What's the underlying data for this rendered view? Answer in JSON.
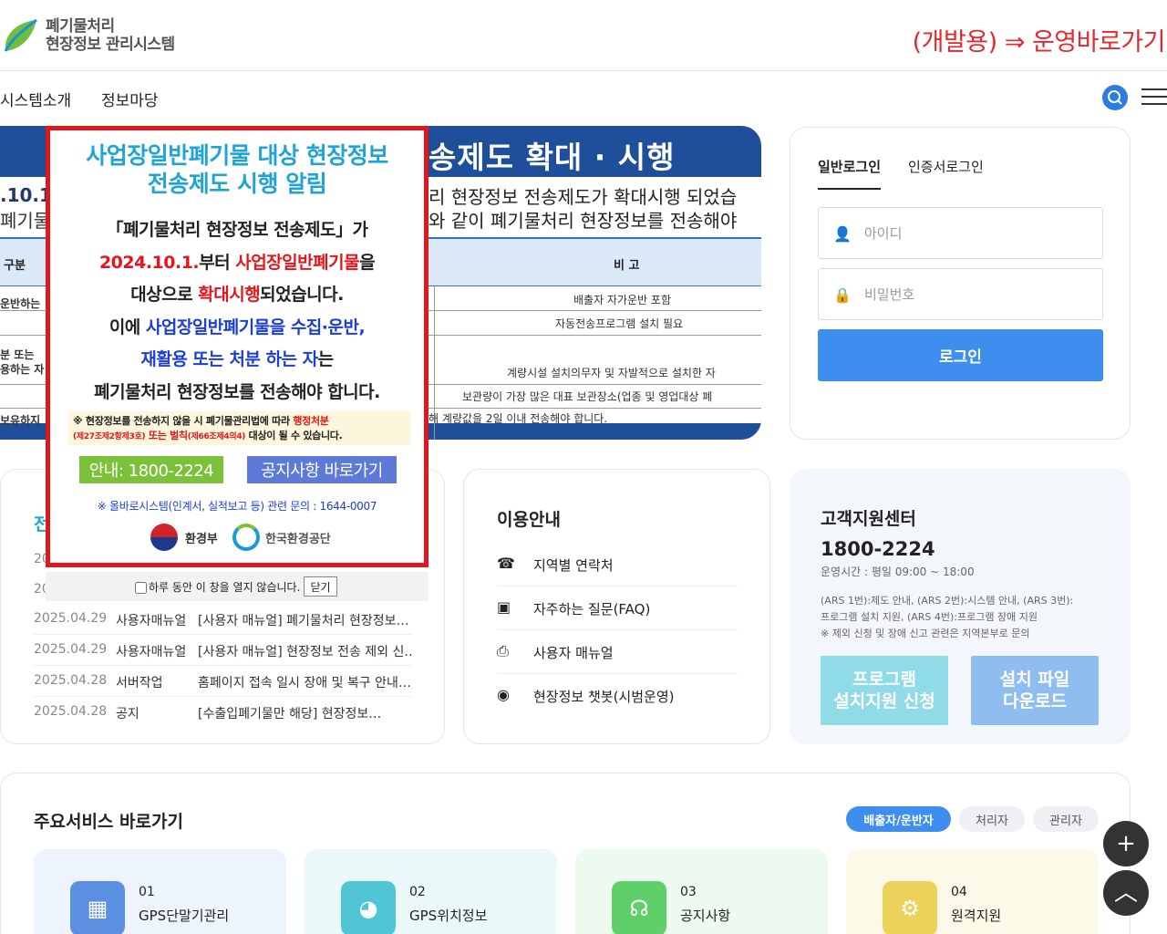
{
  "header": {
    "logo_line1": "폐기물처리",
    "logo_line2": "현장정보 관리시스템",
    "dev_link": "(개발용) ⇒ 운영바로가기",
    "logo_icon": "leaf-logo-icon"
  },
  "nav": {
    "items": [
      "시스템소개",
      "정보마당"
    ],
    "search_icon": "search-icon",
    "menu_icon": "hamburger-menu-icon"
  },
  "banner": {
    "title": "송제도 확대 · 시행",
    "date_fragment": ".10.1",
    "left_fragment": "폐기물",
    "line1": "리 현장정보 전송제도가 확대시행 되었습",
    "line2": "와 같이 폐기물처리 현장정보를 전송해야",
    "table": {
      "col1_header": "구분",
      "col2_header": "비 고",
      "left_cells": [
        "운반하는",
        "분 또는",
        "용하는 자",
        "보유하지"
      ],
      "right_cells": [
        "배출자 자가운반 포함",
        "자동전송프로그램 설치 필요",
        "계량시설 설치의무자 및 자발적으로 설치한 자",
        "보관량이 가장 많은 대표 보관장소(업종 및 영업대상 폐",
        "해 계량값을 2일 이내 전송해야 합니다."
      ]
    }
  },
  "login": {
    "tabs": [
      "일반로그인",
      "인증서로그인"
    ],
    "id_placeholder": "아이디",
    "pw_placeholder": "비밀번호",
    "submit": "로그인",
    "user_icon": "user-icon",
    "lock_icon": "lock-icon"
  },
  "board": {
    "partial_dates": [
      "20",
      "20"
    ],
    "rows": [
      {
        "date": "2025.04.29",
        "category": "사용자매뉴얼",
        "title": "[사용자 매뉴얼] 폐기물처리 현장정보…"
      },
      {
        "date": "2025.04.29",
        "category": "사용자매뉴얼",
        "title": "[사용자 매뉴얼] 현장정보 전송 제외 신…"
      },
      {
        "date": "2025.04.28",
        "category": "서버작업",
        "title": "홈페이지 접속 일시 장애 및 복구 안내…"
      },
      {
        "date": "2025.04.28",
        "category": "공지",
        "title": "[수출입폐기물만 해당] 현장정보…"
      }
    ],
    "partial_tab": "전"
  },
  "guide": {
    "title": "이용안내",
    "items": [
      {
        "icon": "phone-icon",
        "label": "지역별 연락처"
      },
      {
        "icon": "faq-icon",
        "label": "자주하는 질문(FAQ)"
      },
      {
        "icon": "manual-icon",
        "label": "사용자 매뉴얼"
      },
      {
        "icon": "chatbot-icon",
        "label": "현장정보 챗봇(시범운영)"
      }
    ]
  },
  "support": {
    "title": "고객지원센터",
    "phone": "1800-2224",
    "hours": "운영시간 : 평일 09:00 ~ 18:00",
    "ars1": "(ARS 1번):제도 안내, (ARS 2번):시스템 안내, (ARS 3번):",
    "ars2": "프로그램 설치 지원, (ARS 4번):프로그램 장애 지원",
    "ars3": "※ 제외 신청 및 장애 신고 관련은 지역본부로 문의",
    "btn_install_1": "프로그램",
    "btn_install_2": "설치지원 신청",
    "btn_download_1": "설치 파일",
    "btn_download_2": "다운로드"
  },
  "services": {
    "title": "주요서비스 바로가기",
    "tabs": [
      "배출자/운반자",
      "처리자",
      "관리자"
    ],
    "tiles": [
      {
        "num": "01",
        "label": "GPS단말기관리",
        "color": "#5b8fe0",
        "bg": "#eef4fd",
        "icon": "building-icon"
      },
      {
        "num": "02",
        "label": "GPS위치정보",
        "color": "#4fc5d6",
        "bg": "#ebf8fa",
        "icon": "router-icon"
      },
      {
        "num": "03",
        "label": "공지사항",
        "color": "#5fcf6a",
        "bg": "#eefaf0",
        "icon": "headset-icon"
      },
      {
        "num": "04",
        "label": "원격지원",
        "color": "#ecd25a",
        "bg": "#fdf9e8",
        "icon": "remote-support-icon"
      }
    ]
  },
  "floating": {
    "add_label": "+",
    "top_label": "︿",
    "add_icon": "plus-icon",
    "top_icon": "scroll-top-icon"
  },
  "popup": {
    "title_line1": "사업장일반폐기물 대상 현장정보",
    "title_line2": "전송제도 시행 알림",
    "l1": "「폐기물처리 현장정보 전송제도」가",
    "l2a": "2024.10.1.",
    "l2b": "부터 ",
    "l2c": "사업장일반폐기물",
    "l2d": "을",
    "l3a": "대상으로 ",
    "l3b": "확대시행",
    "l3c": "되었습니다.",
    "l4a": "이에 ",
    "l4b": "사업장일반폐기물을 수집·운반,",
    "l5a": "재활용 또는 처분 하는 자",
    "l5b": "는",
    "l6": "폐기물처리 현장정보를 전송해야 합니다.",
    "warn1a": "※ 현장정보를 전송하지 않을 시 폐기물관리법에 따라 ",
    "warn1b": "행정처분",
    "warn2a": "(제27조제2항제3호)",
    "warn2b": " 또는 ",
    "warn2c": "벌칙",
    "warn2d": "(제66조제4의4)",
    "warn2e": " 대상이 될 수 있습니다.",
    "btn_info": "안내: 1800-2224",
    "btn_notice": "공지사항 바로가기",
    "inquiry": "※ 올바로시스템(인계서, 실적보고 등) 관련 문의 : 1644-0007",
    "org1": "환경부",
    "org2": "한국환경공단",
    "dont_show": "하루 동안 이 창을 열지 않습니다.",
    "close": "닫기"
  }
}
